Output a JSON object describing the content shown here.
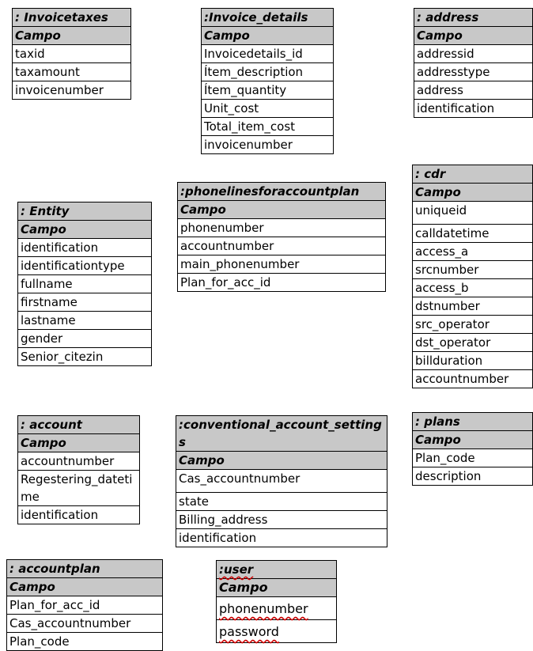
{
  "tables": {
    "invoicetaxes": {
      "title": ": Invoicetaxes",
      "header": "Campo",
      "fields": [
        "taxid",
        "taxamount",
        "invoicenumber"
      ]
    },
    "invoice_details": {
      "title": ":Invoice_details",
      "header": "Campo",
      "fields": [
        "Invoicedetails_id",
        "Ítem_description",
        "Ítem_quantity",
        "Unit_cost",
        "Total_item_cost",
        "invoicenumber"
      ]
    },
    "address": {
      "title": ": address",
      "header": "Campo",
      "fields": [
        "addressid",
        "addresstype",
        "address",
        "identification"
      ]
    },
    "cdr": {
      "title": ": cdr",
      "header": "Campo",
      "fields": [
        "uniqueid",
        "calldatetime",
        "access_a",
        "srcnumber",
        "access_b",
        "dstnumber",
        "src_operator",
        "dst_operator",
        "billduration",
        "accountnumber"
      ]
    },
    "phonelines": {
      "title": ":phonelinesforaccountplan",
      "header": "Campo",
      "fields": [
        "phonenumber",
        "accountnumber",
        "main_phonenumber",
        "Plan_for_acc_id"
      ]
    },
    "entity": {
      "title": ": Entity",
      "header": "Campo",
      "fields": [
        "identification",
        "identificationtype",
        "fullname",
        "firstname",
        "lastname",
        "gender",
        "Senior_citezin"
      ]
    },
    "account": {
      "title": ": account",
      "header": "Campo",
      "fields": [
        "accountnumber",
        "Regestering_datetime",
        "identification"
      ]
    },
    "conventional": {
      "title": ":conventional_account_settings",
      "header": "Campo",
      "fields": [
        "Cas_accountnumber",
        "state",
        "Billing_address",
        "identification"
      ]
    },
    "plans": {
      "title": ": plans",
      "header": "Campo",
      "fields": [
        "Plan_code",
        "description"
      ]
    },
    "accountplan": {
      "title": ": accountplan",
      "header": "Campo",
      "fields": [
        "Plan_for_acc_id",
        "Cas_accountnumber",
        "Plan_code"
      ]
    },
    "user": {
      "title": ":user",
      "header": "Campo",
      "fields": [
        "phonenumber",
        "password"
      ]
    }
  }
}
